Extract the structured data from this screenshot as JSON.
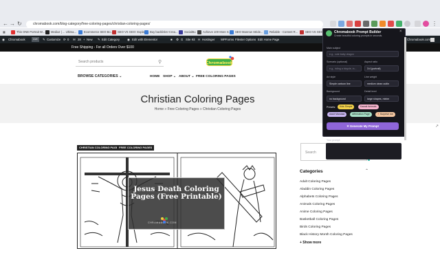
{
  "browser": {
    "url": "chromabook.com/blog-category/free-coloring-pages/christian-coloring-pages/",
    "bookmarks": [
      "This ONE Portrait W...",
      "Mediaz | ... Ultima...",
      "Ecommerce SEO Bo...",
      "SEO VS GEO: Explain...",
      "Buy backlinks! Crea...",
      "SocialBu",
      "Achieve 100 More S...",
      "SEO Manrow Stride...",
      "Reliable - Content R...",
      "SEO VS GEO: Exp"
    ]
  },
  "admin_bar": {
    "items": [
      "Chromabook",
      "Customize",
      "0",
      "28",
      "New",
      "Edit Category",
      "Edit with Elementor",
      "Site Kit",
      "Hostinger",
      "WPForms",
      "Filester Options",
      "Edit Home Page"
    ],
    "right_text": "Chromabook.com"
  },
  "promo": {
    "text": "Free Shipping - For all Orders Over $100"
  },
  "header": {
    "search_placeholder": "Search products",
    "categories_label": "BROWSE CATEGORIES",
    "nav": [
      "HOME",
      "SHOP",
      "ABOUT",
      "FREE COLORING PAGES"
    ]
  },
  "page": {
    "title": "Christian Coloring Pages",
    "breadcrumb": "Home » Free Coloring Pages » Christian Coloring Pages"
  },
  "post": {
    "tags": [
      "CHRISTIAN COLORING PAGES",
      "FREE COLORING PAGES"
    ],
    "overlay_title": "Jesus Death Coloring Pages (Free Printable)",
    "overlay_site": "CHROMABOOK.COM"
  },
  "sidebar": {
    "search_placeholder": "Search",
    "categories_heading": "Categories",
    "categories": [
      "Adult Coloring Pages",
      "Aladdin Coloring Pages",
      "Alphabets Coloring Pages",
      "Animals Coloring Pages",
      "Anime Coloring Pages",
      "Basketball Coloring Pages",
      "Birds Coloring Pages",
      "Black History Month Coloring Pages"
    ],
    "show_more": "+ Show more"
  },
  "popup": {
    "title": "Chromabook Prompt Builder",
    "subtitle": "Create beautiful coloring prompts in seconds.",
    "main_subject_label": "Main subject",
    "main_subject_placeholder": "e.g., cute baby dragon",
    "scenario_label": "Scenario (optional)",
    "scenario_placeholder": "e.g., riding a bicycle, in...",
    "aspect_label": "Aspect ratio",
    "aspect_value": "3:4 (portrait)",
    "art_style_label": "Art style",
    "art_style_value": "Simple cartoon line",
    "line_weight_label": "Line weight",
    "line_weight_value": "medium clean outlin",
    "background_label": "Background",
    "background_value": "no background",
    "detail_label": "Detail level",
    "detail_value": "large shapes, minim",
    "presets_label": "Presets:",
    "presets": [
      {
        "label": "Kids Simple",
        "color": "#f5d34a"
      },
      {
        "label": "Kawaii Animals",
        "color": "#f7b5cf"
      },
      {
        "label": "Adult Mandala",
        "color": "#c9b6f2"
      },
      {
        "label": "Affirmation Page",
        "color": "#a8e0c8"
      },
      {
        "label": "Surprise me",
        "color": "#f3c6a0"
      }
    ],
    "generate_label": "Generate My Prompt",
    "your_prompt_label": "Your prompt"
  }
}
